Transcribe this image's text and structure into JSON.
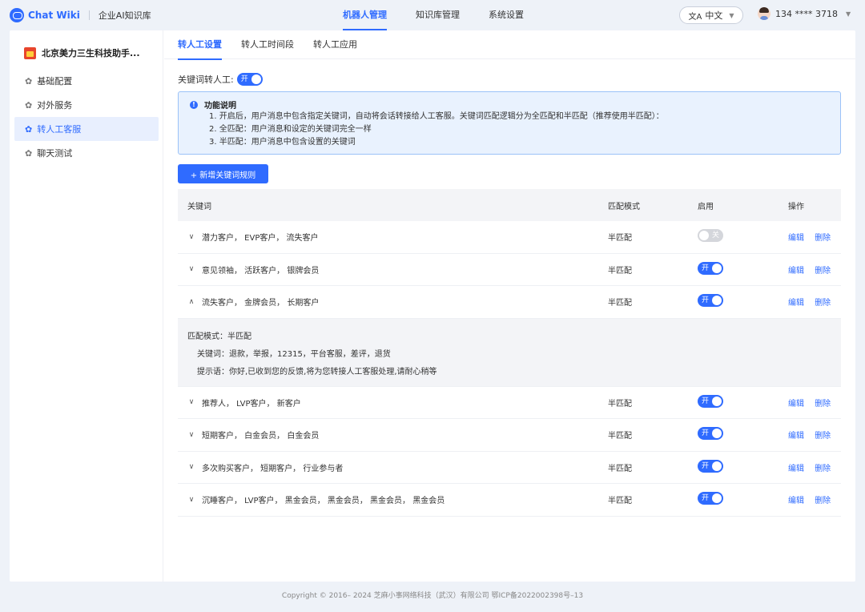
{
  "app": {
    "brand": "Chat Wiki",
    "subtitle": "企业AI知识库"
  },
  "topnav": {
    "items": [
      "机器人管理",
      "知识库管理",
      "系统设置"
    ],
    "language": "中文",
    "user_phone": "134 **** 3718"
  },
  "sidebar": {
    "robot_name": "北京美力三生科技助手...",
    "items": [
      {
        "label": "基础配置",
        "icon": "gear-icon"
      },
      {
        "label": "对外服务",
        "icon": "gear-icon"
      },
      {
        "label": "转人工客服",
        "icon": "gear-icon"
      },
      {
        "label": "聊天测试",
        "icon": "gear-icon"
      }
    ],
    "active_index": 2
  },
  "tabs": [
    "转人工设置",
    "转人工时间段",
    "转人工应用"
  ],
  "keyword_switch": {
    "label": "关键词转人工:",
    "state": "开"
  },
  "info": {
    "title": "功能说明",
    "lines": [
      "1. 开启后，用户消息中包含指定关键词，自动将会话转接给人工客服。关键词匹配逻辑分为全匹配和半匹配（推荐使用半匹配）：",
      "2. 全匹配：用户消息和设定的关键词完全一样",
      "3. 半匹配：用户消息中包含设置的关键词"
    ]
  },
  "add_button": "+ 新增关键词规则",
  "table": {
    "headers": {
      "keyword": "关键词",
      "mode": "匹配模式",
      "enable": "启用",
      "op": "操作"
    },
    "edit_label": "编辑",
    "delete_label": "删除",
    "rows": [
      {
        "keywords": "潜力客户，  EVP客户，  流失客户",
        "mode": "半匹配",
        "enabled": "关",
        "expanded": false
      },
      {
        "keywords": "意见领袖，  活跃客户，  银牌会员",
        "mode": "半匹配",
        "enabled": "开",
        "expanded": false
      },
      {
        "keywords": "流失客户，  金牌会员，  长期客户",
        "mode": "半匹配",
        "enabled": "开",
        "expanded": true
      },
      {
        "keywords": "推荐人，  LVP客户，  新客户",
        "mode": "半匹配",
        "enabled": "开",
        "expanded": false
      },
      {
        "keywords": "短期客户，  白金会员，  白金会员",
        "mode": "半匹配",
        "enabled": "开",
        "expanded": false
      },
      {
        "keywords": "多次购买客户，  短期客户，  行业参与者",
        "mode": "半匹配",
        "enabled": "开",
        "expanded": false
      },
      {
        "keywords": "沉睡客户，  LVP客户，  黑金会员，  黑金会员，  黑金会员，  黑金会员",
        "mode": "半匹配",
        "enabled": "开",
        "expanded": false
      }
    ],
    "detail": {
      "mode_label": "匹配模式：",
      "mode_value": "半匹配",
      "keywords_label": "关键词：",
      "keywords_value": "退款，举报，12315，平台客服，差评，退货",
      "prompt_label": "提示语：",
      "prompt_value": "你好,已收到您的反馈,将为您转接人工客服处理,请耐心稍等"
    }
  },
  "footer": "Copyright © 2016– 2024 芝麻小事网络科技（武汉）有限公司 鄂ICP备2022002398号–13"
}
